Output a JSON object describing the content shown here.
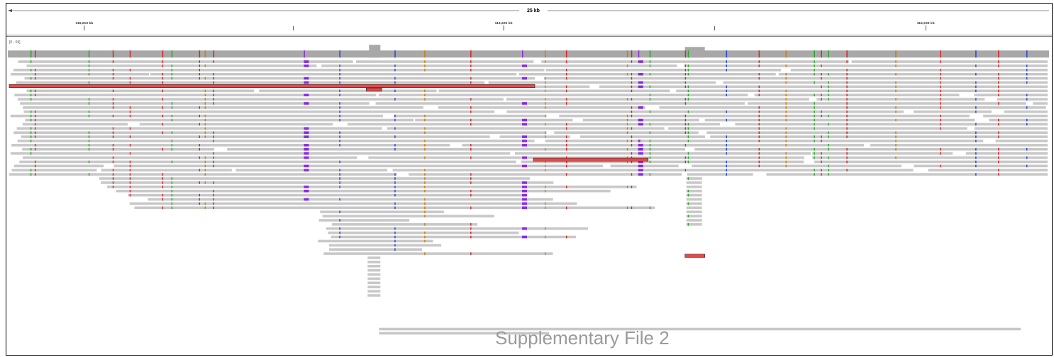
{
  "ruler": {
    "span_label": "25 kb",
    "ticks": [
      {
        "label": "116,210 kb"
      },
      {
        "label": "116,220 kb"
      },
      {
        "label": "116,230 kb"
      }
    ]
  },
  "coverage_track": {
    "range_label": "[0 - 69]"
  },
  "watermark": "Supplementary File 2",
  "colors": {
    "read": "#c8c8c8",
    "coverage": "#a8a8a8",
    "insertion": "#8a2be2",
    "mismatch_A": "#22aa22",
    "mismatch_T": "#dd2222",
    "mismatch_C": "#2244dd",
    "mismatch_G": "#d17c00",
    "highlight_read": "#e34a4a"
  }
}
